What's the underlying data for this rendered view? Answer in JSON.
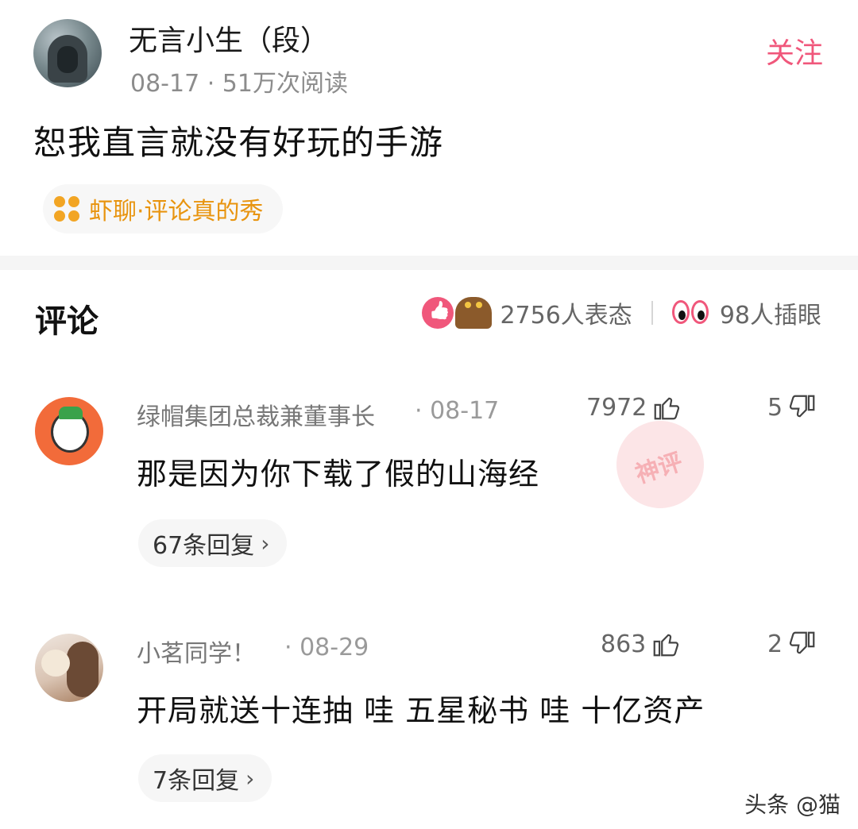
{
  "post": {
    "author": "无言小生（段）",
    "meta": "08-17 · 51万次阅读",
    "follow_label": "关注",
    "text": "恕我直言就没有好玩的手游",
    "topic": "虾聊·评论真的秀"
  },
  "comments_section": {
    "title": "评论",
    "reactions_count": "2756人表态",
    "eyes_count": "98人插眼"
  },
  "comments": [
    {
      "author": "绿帽集团总裁兼董事长",
      "time": "· 08-17",
      "likes": "7972",
      "dislikes": "5",
      "text": "那是因为你下载了假的山海经",
      "replies": "67条回复",
      "stamp": "神评"
    },
    {
      "author": "小茗同学！",
      "time": "· 08-29",
      "likes": "863",
      "dislikes": "2",
      "text": "开局就送十连抽 哇 五星秘书 哇 十亿资产",
      "replies": "7条回复"
    }
  ],
  "watermark": "头条 @猫"
}
